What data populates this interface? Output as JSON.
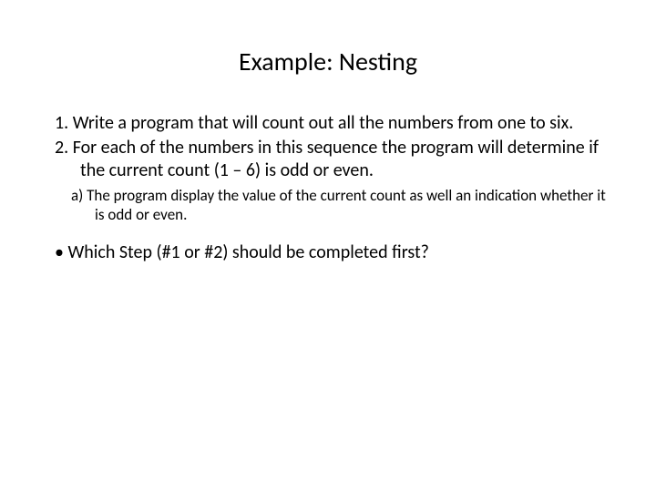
{
  "title": "Example: Nesting",
  "items": {
    "n1": "1. Write a program that will count out all the numbers from one to six.",
    "n2": "2. For each of the numbers in this sequence the program will determine if the current count (1 – 6) is odd or even.",
    "sub_a": "a) The program display the value of the current count as well an indication whether it is odd or even.",
    "bullet": "Which Step (#1 or #2) should be completed first?"
  }
}
